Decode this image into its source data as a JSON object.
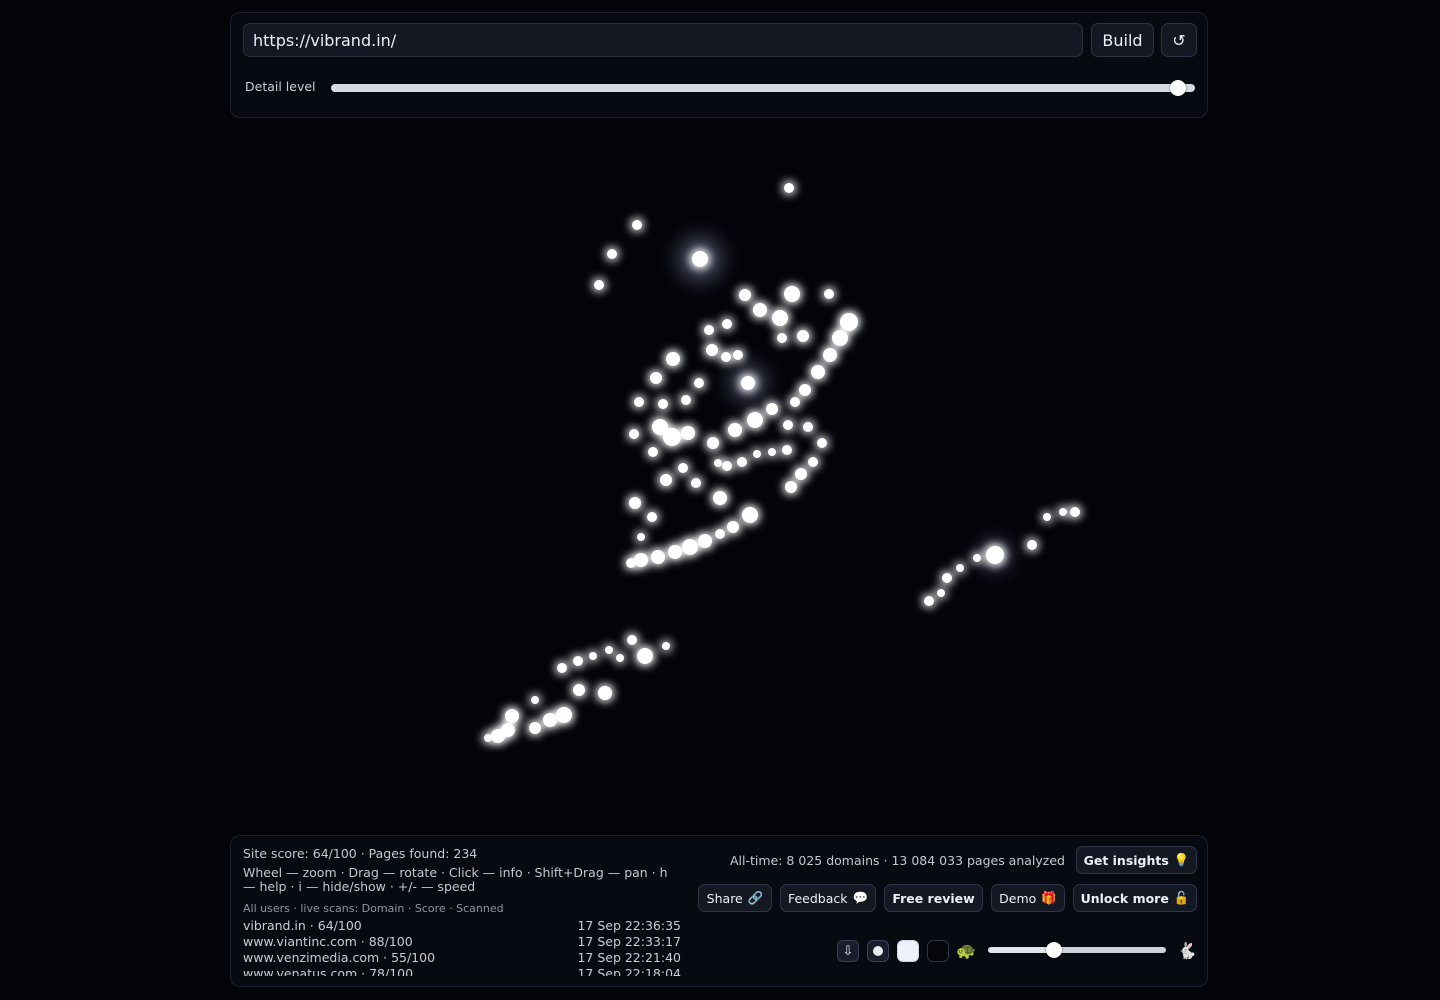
{
  "url_input": {
    "value": "https://vibrand.in/"
  },
  "buttons": {
    "build": "Build",
    "reload_icon": "↺"
  },
  "detail": {
    "label": "Detail level",
    "value": 0.98
  },
  "stats": {
    "site": "Site score: 64/100 · Pages found: 234",
    "help": "Wheel — zoom · Drag — rotate · Click — info · Shift+Drag — pan · h — help · i — hide/show · +/- — speed",
    "feed_header": "All users · live scans: Domain · Score · Scanned",
    "alltime": "All-time: 8 025 domains · 13 084 033 pages analyzed"
  },
  "feed": [
    {
      "domain": "vibrand.in · 64/100",
      "time": "17 Sep 22:36:35"
    },
    {
      "domain": "www.viantinc.com · 88/100",
      "time": "17 Sep 22:33:17"
    },
    {
      "domain": "www.venzimedia.com · 55/100",
      "time": "17 Sep 22:21:40"
    },
    {
      "domain": "www.venatus.com · 78/100",
      "time": "17 Sep 22:18:04"
    }
  ],
  "actions": {
    "get_insights": "Get insights",
    "get_insights_icon": "💡",
    "share": "Share",
    "share_icon": "🔗",
    "feedback": "Feedback",
    "feedback_icon": "💬",
    "free_review": "Free review",
    "demo": "Demo",
    "demo_icon": "🎁",
    "unlock": "Unlock more",
    "unlock_icon": "🔓"
  },
  "controls": {
    "download_icon": "⇩",
    "turtle_icon": "🐢",
    "rabbit_icon": "🐇",
    "speed_value": 0.37
  },
  "icons": {
    "reload": "reload-icon",
    "download": "download-icon",
    "turtle": "turtle-icon",
    "rabbit": "rabbit-icon"
  },
  "colors": {
    "background": "#03040a",
    "panel": "#080a12",
    "glow": "#ffffff"
  }
}
